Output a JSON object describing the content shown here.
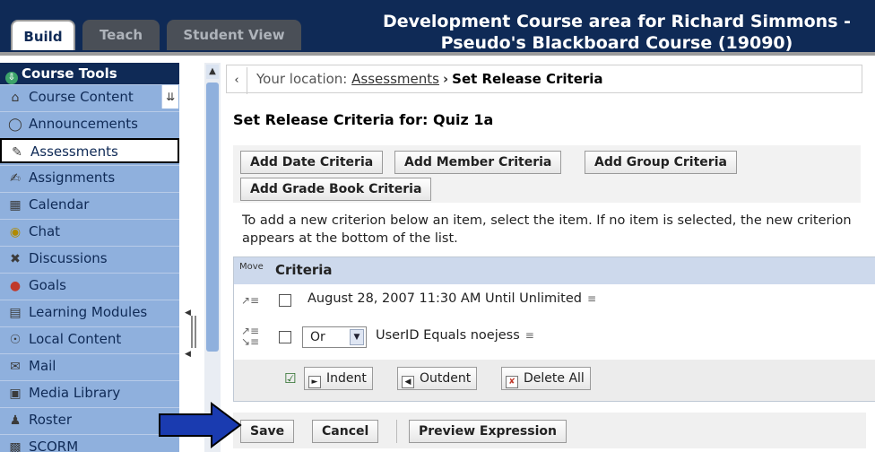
{
  "tabs": [
    {
      "label": "Build"
    },
    {
      "label": "Teach"
    },
    {
      "label": "Student View"
    }
  ],
  "course_title_line1": "Development Course area for Richard Simmons -",
  "course_title_line2": "Pseudo's Blackboard Course (19090)",
  "sidebar": {
    "header": "Course Tools",
    "items": [
      {
        "label": "Course Content",
        "icon": "folder-icon"
      },
      {
        "label": "Announcements",
        "icon": "megaphone-icon"
      },
      {
        "label": "Assessments",
        "icon": "assessment-icon"
      },
      {
        "label": "Assignments",
        "icon": "assignment-icon"
      },
      {
        "label": "Calendar",
        "icon": "calendar-icon"
      },
      {
        "label": "Chat",
        "icon": "chat-icon"
      },
      {
        "label": "Discussions",
        "icon": "discussion-icon"
      },
      {
        "label": "Goals",
        "icon": "goals-icon"
      },
      {
        "label": "Learning Modules",
        "icon": "module-icon"
      },
      {
        "label": "Local Content",
        "icon": "local-content-icon"
      },
      {
        "label": "Mail",
        "icon": "mail-icon"
      },
      {
        "label": "Media Library",
        "icon": "media-icon"
      },
      {
        "label": "Roster",
        "icon": "roster-icon"
      },
      {
        "label": "SCORM",
        "icon": "scorm-icon"
      }
    ]
  },
  "breadcrumb": {
    "prefix": "Your location:",
    "link": "Assessments",
    "current": "Set Release Criteria"
  },
  "page_title": "Set Release Criteria for: Quiz 1a",
  "buttons": {
    "add_date": "Add Date Criteria",
    "add_member": "Add Member Criteria",
    "add_group": "Add Group Criteria",
    "add_grade": "Add Grade Book Criteria"
  },
  "instructions": "To add a new criterion below an item, select the item. If no item is selected, the new criterion appears at the bottom of the list.",
  "criteria": {
    "move_label": "Move",
    "header": "Criteria",
    "rows": [
      {
        "text": "August 28, 2007 11:30 AM Until Unlimited"
      },
      {
        "operator": "Or",
        "text": "UserID Equals noejess"
      }
    ],
    "actions": {
      "indent": "Indent",
      "outdent": "Outdent",
      "delete_all": "Delete All"
    }
  },
  "footer": {
    "save": "Save",
    "cancel": "Cancel",
    "preview": "Preview Expression"
  },
  "colors": {
    "header_bg": "#0f2a56",
    "sidebar_bg": "#8fb0dd",
    "arrow": "#1a3bb0"
  }
}
